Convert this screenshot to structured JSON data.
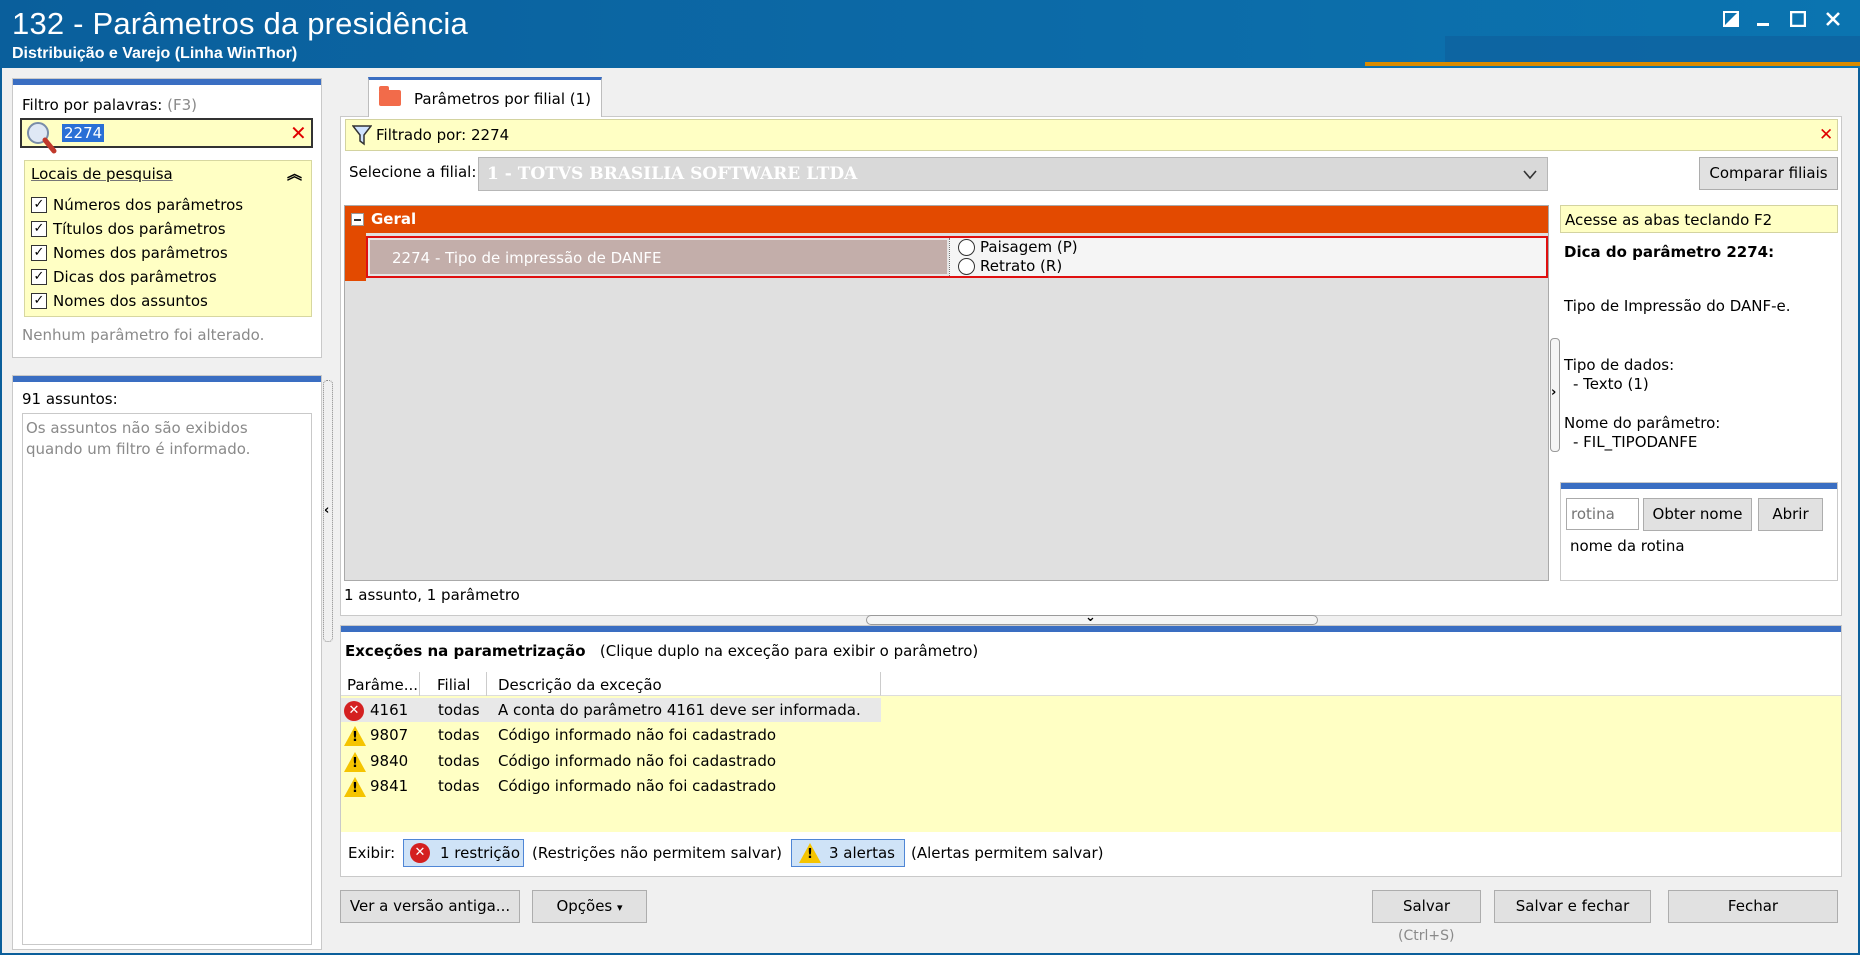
{
  "window": {
    "title": "132 - Parâmetros da presidência",
    "subtitle": "Distribuição e Varejo (Linha WinThor)",
    "controls": [
      "restore-icon",
      "minimize-icon",
      "maximize-icon",
      "close-icon"
    ]
  },
  "filter": {
    "label": "Filtro por palavras:",
    "shortcut": "(F3)",
    "value": "2274"
  },
  "locais": {
    "title": "Locais de pesquisa",
    "items": [
      {
        "label": "Números dos parâmetros",
        "checked": true
      },
      {
        "label": "Títulos dos parâmetros",
        "checked": true
      },
      {
        "label": "Nomes dos parâmetros",
        "checked": true
      },
      {
        "label": "Dicas dos parâmetros",
        "checked": true
      },
      {
        "label": "Nomes dos assuntos",
        "checked": true
      }
    ],
    "status": "Nenhum parâmetro foi alterado."
  },
  "assuntos": {
    "count_label": "91 assuntos:",
    "message": "Os assuntos não são exibidos quando um filtro é informado."
  },
  "tab": {
    "label": "Parâmetros por filial  (1)"
  },
  "filterbar": {
    "text": "Filtrado por: 2274"
  },
  "filial": {
    "label": "Selecione a filial:",
    "value": "1 - TOTVS BRASILIA SOFTWARE LTDA",
    "compare_button": "Comparar filiais"
  },
  "grid": {
    "group": "Geral",
    "param_name": "2274 - Tipo de impressão de DANFE",
    "options": [
      "Paisagem (P)",
      "Retrato (R)"
    ],
    "summary": "1 assunto, 1 parâmetro"
  },
  "tip": {
    "hint": "Acesse as abas teclando F2",
    "title": "Dica do parâmetro 2274:",
    "description": "Tipo de Impressão do DANF-e.",
    "datatype_label": "Tipo de dados:",
    "datatype_value": "- Texto (1)",
    "paramname_label": "Nome do parâmetro:",
    "paramname_value": "- FIL_TIPODANFE"
  },
  "rotina": {
    "placeholder": "rotina",
    "obter_button": "Obter nome",
    "abrir_button": "Abrir",
    "name_label": "nome da rotina"
  },
  "excecoes": {
    "title": "Exceções na parametrização",
    "subtitle": "(Clique duplo na exceção para exibir o parâmetro)",
    "columns": [
      "Parâme...",
      "Filial",
      "Descrição da exceção"
    ],
    "rows": [
      {
        "type": "error",
        "param": "4161",
        "filial": "todas",
        "descricao": "A conta do parâmetro 4161 deve ser informada."
      },
      {
        "type": "warning",
        "param": "9807",
        "filial": "todas",
        "descricao": "Código informado não foi cadastrado"
      },
      {
        "type": "warning",
        "param": "9840",
        "filial": "todas",
        "descricao": "Código informado não foi cadastrado"
      },
      {
        "type": "warning",
        "param": "9841",
        "filial": "todas",
        "descricao": "Código informado não foi cadastrado"
      }
    ],
    "exibir_label": "Exibir:",
    "restricao_button": "1 restrição",
    "restricao_note": "(Restrições não permitem salvar)",
    "alertas_button": "3 alertas",
    "alertas_note": "(Alertas permitem salvar)"
  },
  "footer": {
    "versao_button": "Ver a versão antiga...",
    "opcoes_button": "Opções",
    "salvar_button": "Salvar",
    "salvar_shortcut": "(Ctrl+S)",
    "salvar_fechar_button": "Salvar e fechar",
    "fechar_button": "Fechar"
  },
  "colors": {
    "title_bar": "#0b5f9b",
    "accent_blue": "#3a6ec2",
    "group_orange": "#e34a00",
    "highlight_yellow": "#ffffc4",
    "error_red": "#d42020",
    "warning_yellow": "#f5c400"
  }
}
